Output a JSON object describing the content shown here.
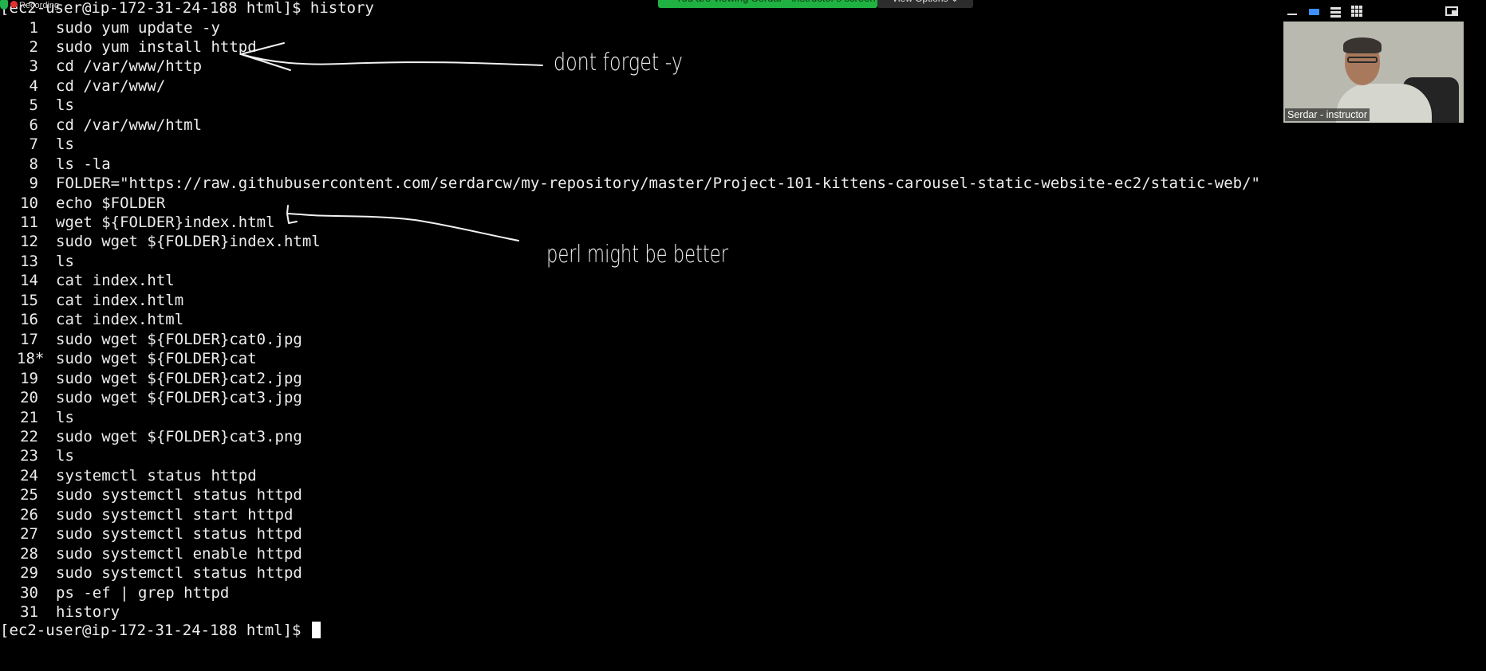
{
  "terminal": {
    "header_prompt": "[ec2-user@ip-172-31-24-188 html]$ history",
    "final_prompt": "[ec2-user@ip-172-31-24-188 html]$ ",
    "history": [
      {
        "num": "1",
        "cmd": "sudo yum update -y"
      },
      {
        "num": "2",
        "cmd": "sudo yum install httpd"
      },
      {
        "num": "3",
        "cmd": "cd /var/www/http"
      },
      {
        "num": "4",
        "cmd": "cd /var/www/"
      },
      {
        "num": "5",
        "cmd": "ls"
      },
      {
        "num": "6",
        "cmd": "cd /var/www/html"
      },
      {
        "num": "7",
        "cmd": "ls"
      },
      {
        "num": "8",
        "cmd": "ls -la"
      },
      {
        "num": "9",
        "cmd": "FOLDER=\"https://raw.githubusercontent.com/serdarcw/my-repository/master/Project-101-kittens-carousel-static-website-ec2/static-web/\""
      },
      {
        "num": "10",
        "cmd": "echo $FOLDER"
      },
      {
        "num": "11",
        "cmd": "wget ${FOLDER}index.html"
      },
      {
        "num": "12",
        "cmd": "sudo wget ${FOLDER}index.html"
      },
      {
        "num": "13",
        "cmd": "ls"
      },
      {
        "num": "14",
        "cmd": "cat index.htl"
      },
      {
        "num": "15",
        "cmd": "cat index.htlm"
      },
      {
        "num": "16",
        "cmd": "cat index.html"
      },
      {
        "num": "17",
        "cmd": "sudo wget ${FOLDER}cat0.jpg"
      },
      {
        "num": "18*",
        "cmd": "sudo wget ${FOLDER}cat"
      },
      {
        "num": "19",
        "cmd": "sudo wget ${FOLDER}cat2.jpg"
      },
      {
        "num": "20",
        "cmd": "sudo wget ${FOLDER}cat3.jpg"
      },
      {
        "num": "21",
        "cmd": "ls"
      },
      {
        "num": "22",
        "cmd": "sudo wget ${FOLDER}cat3.png"
      },
      {
        "num": "23",
        "cmd": "ls"
      },
      {
        "num": "24",
        "cmd": "systemctl status httpd"
      },
      {
        "num": "25",
        "cmd": "sudo systemctl status httpd"
      },
      {
        "num": "26",
        "cmd": "sudo systemctl start httpd"
      },
      {
        "num": "27",
        "cmd": "sudo systemctl status httpd"
      },
      {
        "num": "28",
        "cmd": "sudo systemctl enable httpd"
      },
      {
        "num": "29",
        "cmd": "sudo systemctl status httpd"
      },
      {
        "num": "30",
        "cmd": "ps -ef | grep httpd"
      },
      {
        "num": "31",
        "cmd": "history"
      }
    ]
  },
  "zoom": {
    "share_banner": "You are viewing Serdar - instructor's screen",
    "view_options": "View Options ⌄",
    "recording_label": "Recording",
    "video_label": "Serdar - instructor",
    "colors": {
      "banner_green": "#1fb141",
      "record_red": "#e03131"
    }
  },
  "annotations": {
    "note_1": "dont forget -y",
    "note_2": "perl might be better"
  }
}
